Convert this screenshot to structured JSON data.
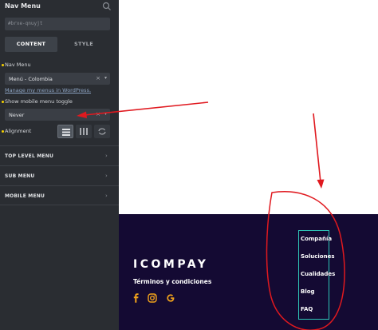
{
  "panel": {
    "title": "Nav Menu",
    "element_id": "#brxe-qnuyjt",
    "tabs": [
      {
        "label": "CONTENT",
        "active": true
      },
      {
        "label": "STYLE",
        "active": false
      }
    ],
    "nav_menu_label": "Nav Menu",
    "nav_menu_value": "Menú - Colombia",
    "manage_link": "Manage my menus in WordPress.",
    "mobile_toggle_label": "Show mobile menu toggle",
    "mobile_toggle_value": "Never",
    "alignment_label": "Alignment",
    "sections": [
      "TOP LEVEL MENU",
      "SUB MENU",
      "MOBILE MENU"
    ]
  },
  "footer": {
    "logo": "ICOMPAY",
    "terms": "Términos y condiciones",
    "social_icons": [
      "facebook-icon",
      "instagram-icon",
      "google-icon"
    ],
    "menu_items": [
      "Compañía",
      "Soluciones",
      "Cualidades",
      "Blog",
      "FAQ"
    ]
  },
  "colors": {
    "panel_bg": "#2a2d32",
    "footer_bg": "#140a33",
    "accent_orange": "#f2a31b",
    "highlight_border": "#2ec4b6",
    "annotation_red": "#e0191f",
    "bullet_yellow": "#f5d000"
  }
}
